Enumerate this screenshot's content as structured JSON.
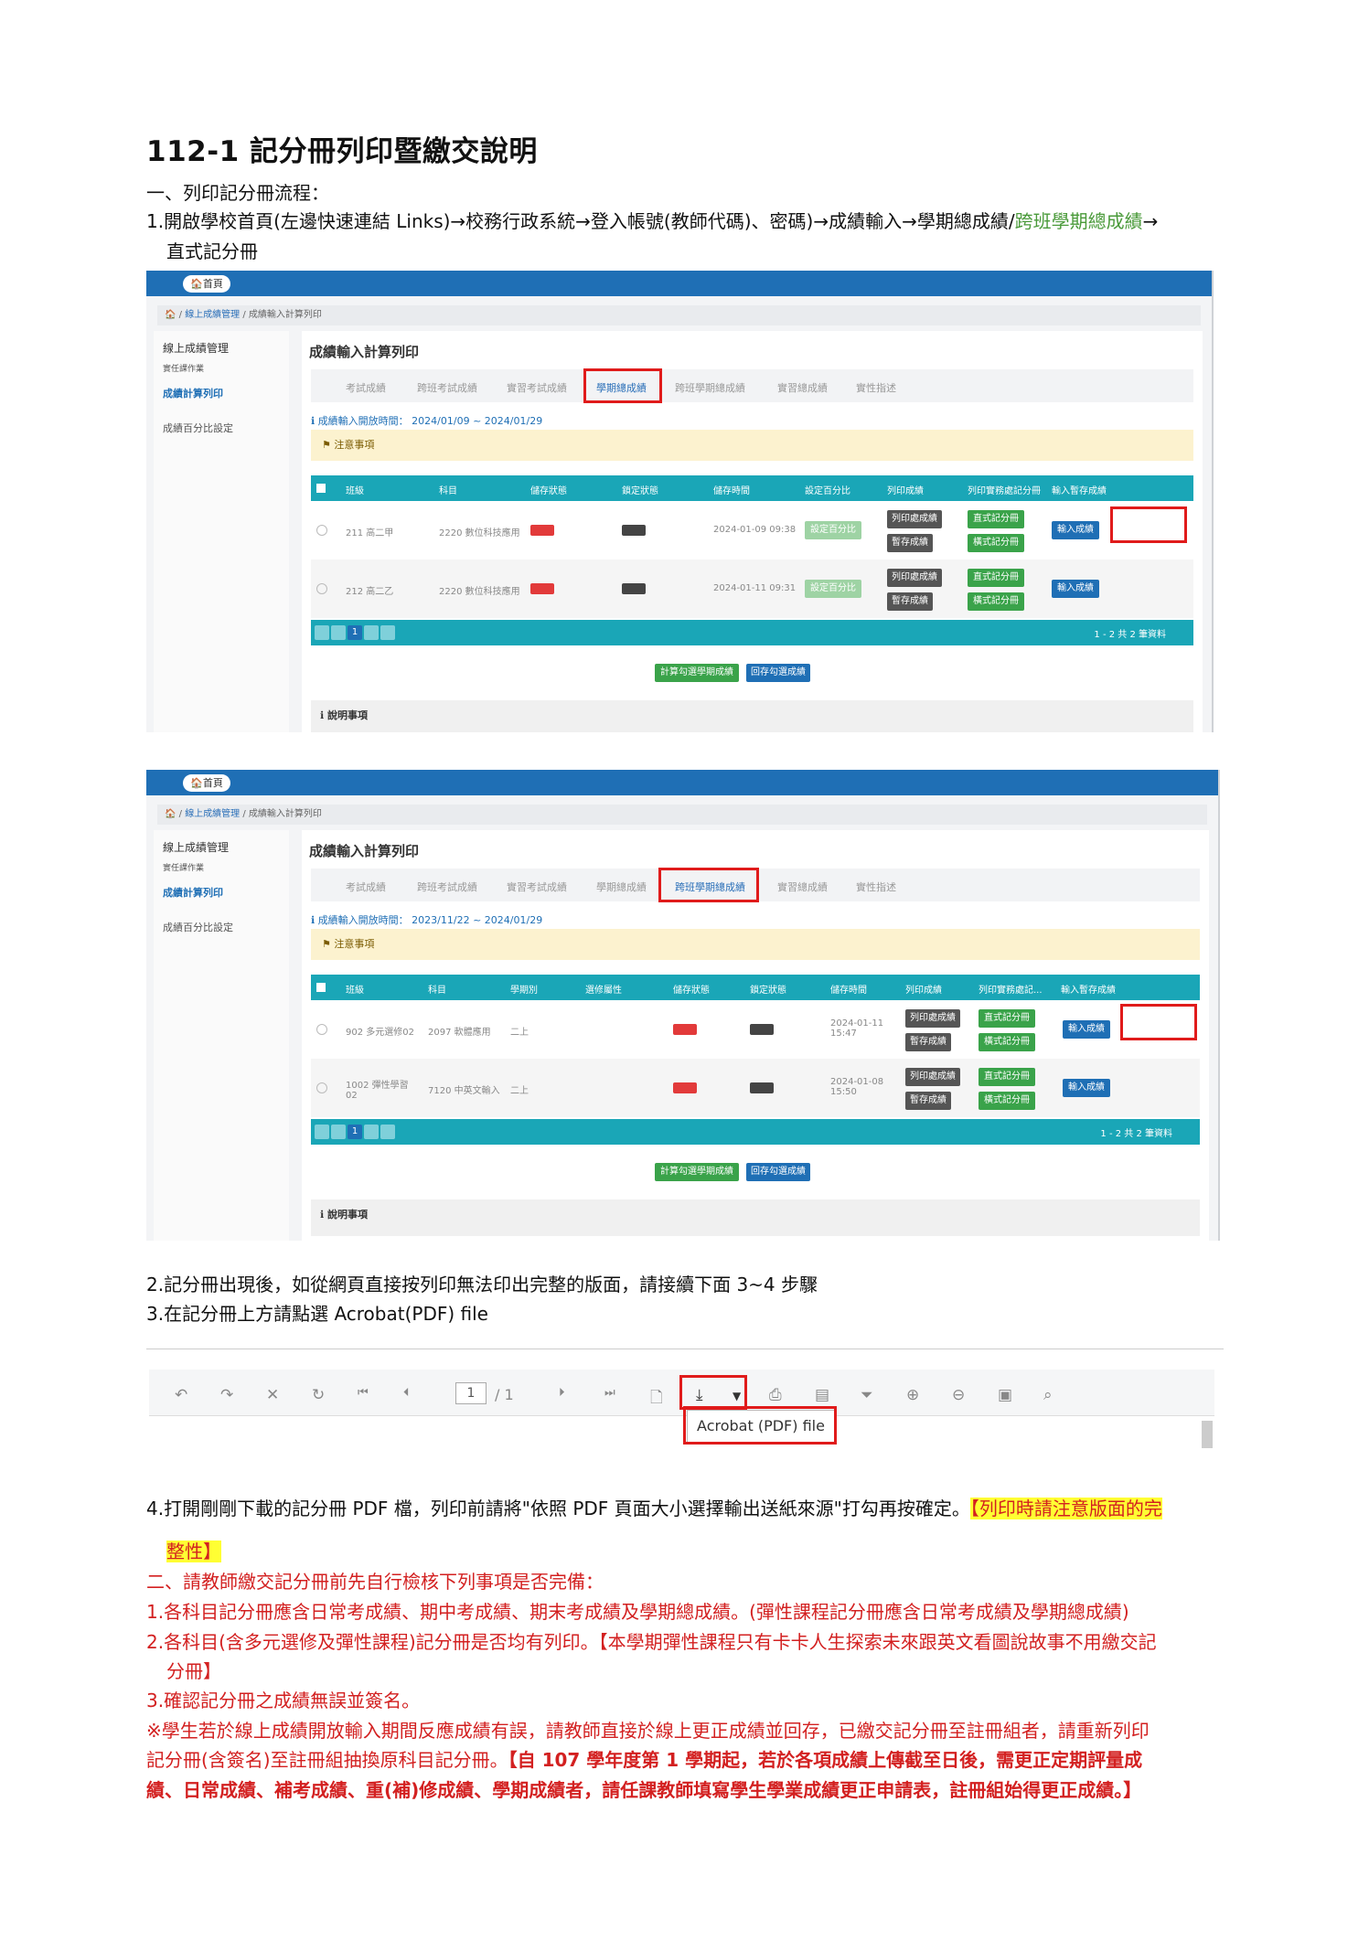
{
  "doc": {
    "title": "112-1 記分冊列印暨繳交說明",
    "section1_heading": "一、列印記分冊流程：",
    "step1_a": "1.開啟學校首頁(左邊快速連結 Links)→校務行政系統→登入帳號(教師代碼)、密碼)→成績輸入→學期總成績/",
    "step1_green": "跨班學期總成績",
    "step1_b": "→",
    "step1_c": "直式記分冊",
    "step2": "2.記分冊出現後，如從網頁直接按列印無法印出完整的版面，請接續下面 3~4 步驟",
    "step3": "3.在記分冊上方請點選 Acrobat(PDF) file",
    "step4_a": "4.打開剛剛下載的記分冊 PDF 檔，列印前請將\"依照 PDF 頁面大小選擇輸出送紙來源\"打勾再按確定。",
    "step4_hl1": "【列印時請注意版面的完",
    "step4_hl2": "整性】",
    "section2_heading": "二、請教師繳交記分冊前先自行檢核下列事項是否完備：",
    "check1": "1.各科目記分冊應含日常考成績、期中考成績、期末考成績及學期總成績。(彈性課程記分冊應含日常考成績及學期總成績)",
    "check2_a": "2.各科目(含多元選修及彈性課程)記分冊是否均有列印。【本學期彈性課程只有卡卡人生探索未來跟英文看圖說故事不用繳交記",
    "check2_b": "分冊】",
    "check3": "3.確認記分冊之成績無誤並簽名。",
    "note_a": "※學生若於線上成績開放輸入期間反應成績有誤，請教師直接於線上更正成績並回存，已繳交記分冊至註冊組者，請重新列印",
    "note_b": "記分冊(含簽名)至註冊組抽換原科目記分冊。",
    "note_b_bold": "【自 107 學年度第 1 學期起，若於各項成績上傳截至日後，需更正定期評量成",
    "note_c_bold": "績、日常成績、補考成績、重(補)修成績、學期成績者，請任課教師填寫學生學業成績更正申請表，註冊組始得更正成績。】"
  },
  "shot1": {
    "home": "首頁",
    "crumb_link": "線上成績管理",
    "crumb_cur": "成績輸入計算列印",
    "sidebar_title": "線上成績管理",
    "sidebar_sub": "實任課作業",
    "sidebar_active": "成績計算列印",
    "sidebar_other": "成績百分比設定",
    "panel_title": "成績輸入計算列印",
    "tabs": [
      "考試成績",
      "跨班考試成績",
      "實習考試成績",
      "學期總成績",
      "跨班學期總成績",
      "實習總成績",
      "實性指述"
    ],
    "period": "成績輸入開放時間：  2024/01/09 ~ 2024/01/29",
    "notice": "注意事項",
    "headers": [
      "班級",
      "科目",
      "儲存狀態",
      "鎖定狀態",
      "儲存時間",
      "設定百分比",
      "列印成績",
      "列印實務處記分冊",
      "輸入暫存成績"
    ],
    "rows": [
      {
        "cls": "211 高二甲",
        "subj": "2220 數位科技應用",
        "time": "2024-01-09 09:38"
      },
      {
        "cls": "212 高二乙",
        "subj": "2220 數位科技應用",
        "time": "2024-01-11 09:31"
      }
    ],
    "btn_pct": "設定百分比",
    "btn_print": "列印處成績",
    "btn_temp": "暫存成績",
    "btn_v": "直式記分冊",
    "btn_h": "橫式記分冊",
    "btn_input": "輸入成績",
    "pager_txt": "1 - 2 共 2 筆資料",
    "pg_cur": "1",
    "btn_calc": "計算勾選學期成績",
    "btn_save": "回存勾選成績",
    "info": "說明事項"
  },
  "shot2": {
    "home": "首頁",
    "crumb_link": "線上成績管理",
    "crumb_cur": "成績輸入計算列印",
    "sidebar_title": "線上成績管理",
    "sidebar_sub": "實任課作業",
    "sidebar_active": "成績計算列印",
    "sidebar_other": "成績百分比設定",
    "panel_title": "成績輸入計算列印",
    "tabs": [
      "考試成績",
      "跨班考試成績",
      "實習考試成績",
      "學期總成績",
      "跨班學期總成績",
      "實習總成績",
      "實性指述"
    ],
    "period": "成績輸入開放時間：  2023/11/22 ~ 2024/01/29",
    "notice": "注意事項",
    "headers": [
      "班級",
      "科目",
      "學期別",
      "選修屬性",
      "儲存狀態",
      "鎖定狀態",
      "儲存時間",
      "列印成績",
      "列印實務處記...",
      "輸入暫存成績"
    ],
    "rows": [
      {
        "cls": "902 多元選修02",
        "subj": "2097 軟體應用",
        "term": "二上",
        "time": "2024-01-11 15:47"
      },
      {
        "cls": "1002 彈性學習 02",
        "subj": "7120 中英文輸入",
        "term": "二上",
        "time": "2024-01-08 15:50"
      }
    ],
    "btn_print": "列印處成績",
    "btn_temp": "暫存成績",
    "btn_v": "直式記分冊",
    "btn_h": "橫式記分冊",
    "btn_input": "輸入成績",
    "pager_txt": "1 - 2 共 2 筆資料",
    "pg_cur": "1",
    "btn_calc": "計算勾選學期成績",
    "btn_save": "回存勾選成績",
    "info": "說明事項"
  },
  "toolbar": {
    "page_current": "1",
    "page_total": "/  1",
    "popup": "Acrobat (PDF) file"
  }
}
